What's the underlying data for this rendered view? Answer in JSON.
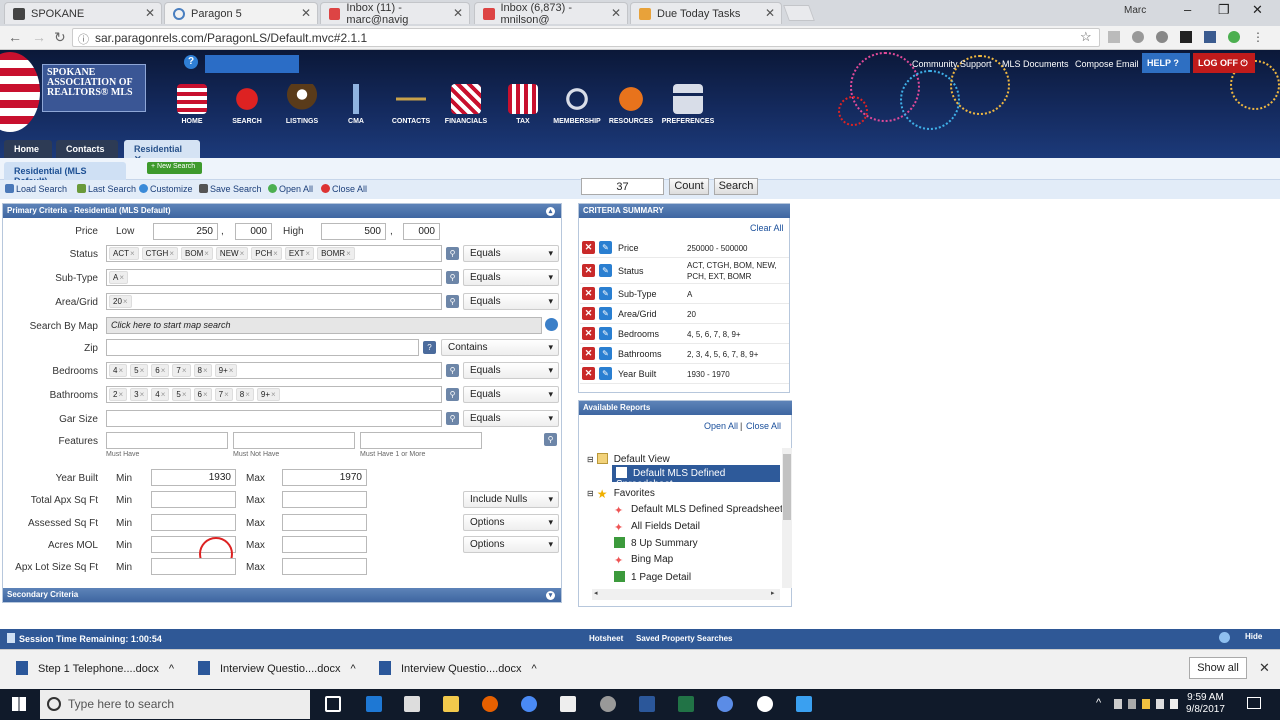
{
  "browser": {
    "tabs": [
      {
        "title": "SPOKANE"
      },
      {
        "title": "Paragon 5"
      },
      {
        "title": "Inbox (11) - marc@navig"
      },
      {
        "title": "Inbox (6,873) - mnilson@"
      },
      {
        "title": "Due Today Tasks"
      }
    ],
    "profile": "Marc",
    "url": "sar.paragonrels.com/ParagonLS/Default.mvc#2.1.1"
  },
  "banner": {
    "logo_text": "SPOKANE ASSOCIATION OF REALTORS® MLS",
    "nav": [
      "HOME",
      "SEARCH",
      "LISTINGS",
      "CMA",
      "CONTACTS",
      "FINANCIALS",
      "TAX",
      "MEMBERSHIP",
      "RESOURCES",
      "PREFERENCES"
    ],
    "links": [
      "Community Support",
      "MLS Documents",
      "Compose Email"
    ],
    "help": "HELP",
    "logoff": "LOG OFF"
  },
  "app_tabs": [
    "Home",
    "Contacts",
    "Residential"
  ],
  "subtab": "Residential (MLS Default)",
  "new_search": "New Search",
  "toolbar": {
    "items": [
      "Load Search",
      "Last Search",
      "Customize",
      "Save Search",
      "Open All",
      "Close All"
    ],
    "count_value": "37",
    "count_label": "Count",
    "search_label": "Search"
  },
  "primary": {
    "title": "Primary Criteria - Residential (MLS Default)",
    "price_label": "Price",
    "low_label": "Low",
    "high_label": "High",
    "price_low": "250",
    "price_low_k": "000",
    "price_high": "500",
    "price_high_k": "000",
    "comma": ",",
    "status_label": "Status",
    "status_chips": [
      "ACT",
      "CTGH",
      "BOM",
      "NEW",
      "PCH",
      "EXT",
      "BOMR"
    ],
    "subtype_label": "Sub-Type",
    "subtype_chips": [
      "A"
    ],
    "area_label": "Area/Grid",
    "area_chips": [
      "20"
    ],
    "map_label": "Search By Map",
    "map_text": "Click here to start map search",
    "zip_label": "Zip",
    "bedrooms_label": "Bedrooms",
    "bedroom_chips": [
      "4",
      "5",
      "6",
      "7",
      "8",
      "9+"
    ],
    "bathrooms_label": "Bathrooms",
    "bathroom_chips": [
      "2",
      "3",
      "4",
      "5",
      "6",
      "7",
      "8",
      "9+"
    ],
    "gar_label": "Gar Size",
    "features_label": "Features",
    "must_have": "Must Have",
    "must_not_have": "Must Not Have",
    "must_have_one": "Must Have 1 or More",
    "equals": "Equals",
    "contains": "Contains",
    "include_nulls": "Include Nulls",
    "options": "Options",
    "min_label": "Min",
    "max_label": "Max",
    "year_label": "Year Built",
    "year_min": "1930",
    "year_max": "1970",
    "total_sqft_label": "Total Apx Sq Ft",
    "assessed_label": "Assessed Sq Ft",
    "acres_label": "Acres MOL",
    "lot_label": "Apx Lot Size Sq Ft"
  },
  "secondary_title": "Secondary Criteria",
  "criteria_summary": {
    "title": "CRITERIA SUMMARY",
    "clear_all": "Clear All",
    "rows": [
      {
        "name": "Price",
        "value": "250000 - 500000"
      },
      {
        "name": "Status",
        "value": "ACT, CTGH, BOM, NEW, PCH, EXT, BOMR"
      },
      {
        "name": "Sub-Type",
        "value": "A"
      },
      {
        "name": "Area/Grid",
        "value": "20"
      },
      {
        "name": "Bedrooms",
        "value": "4, 5, 6, 7, 8, 9+"
      },
      {
        "name": "Bathrooms",
        "value": "2, 3, 4, 5, 6, 7, 8, 9+"
      },
      {
        "name": "Year Built",
        "value": "1930 - 1970"
      }
    ]
  },
  "reports": {
    "title": "Available Reports",
    "open_all": "Open All",
    "sep": "|",
    "close_all": "Close All",
    "default_view": "Default View",
    "default_spreadsheet": "Default MLS Defined Spreadsheet",
    "favorites": "Favorites",
    "favorite_items": [
      "Default MLS Defined Spreadsheet",
      "All Fields Detail",
      "8 Up Summary",
      "Bing Map",
      "1 Page Detail"
    ]
  },
  "statusbar": {
    "session": "Session Time Remaining: 1:00:54",
    "hotsheet": "Hotsheet",
    "saved": "Saved Property Searches",
    "hide": "Hide"
  },
  "downloads": {
    "items": [
      "Step 1 Telephone....docx",
      "Interview Questio....docx",
      "Interview Questio....docx"
    ],
    "show_all": "Show all"
  },
  "taskbar": {
    "search_placeholder": "Type here to search",
    "time": "9:59 AM",
    "date": "9/8/2017"
  }
}
